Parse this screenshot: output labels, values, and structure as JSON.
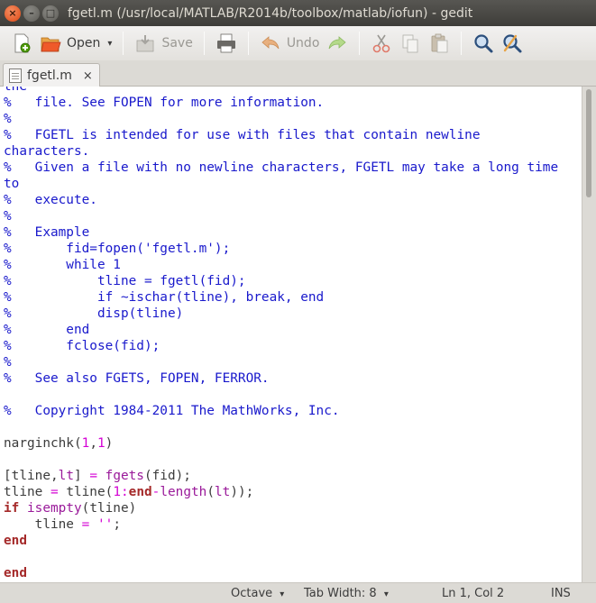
{
  "window": {
    "title": "fgetl.m (/usr/local/MATLAB/R2014b/toolbox/matlab/iofun) - gedit",
    "close_glyph": "×",
    "minimize_glyph": "–",
    "maximize_glyph": "□"
  },
  "toolbar": {
    "new_icon": "new-document-icon",
    "open_label": "Open",
    "open_caret": "▾",
    "save_label": "Save",
    "undo_label": "Undo"
  },
  "tabs": [
    {
      "label": "fgetl.m",
      "close_glyph": "×"
    }
  ],
  "editor": {
    "lines": [
      [
        [
          "c",
          "the"
        ]
      ],
      [
        [
          "c",
          "%   file. See FOPEN for more information."
        ]
      ],
      [
        [
          "c",
          "%"
        ]
      ],
      [
        [
          "c",
          "%   FGETL is intended for use with files that contain newline"
        ]
      ],
      [
        [
          "c",
          "characters."
        ]
      ],
      [
        [
          "c",
          "%   Given a file with no newline characters, FGETL may take a long time"
        ]
      ],
      [
        [
          "c",
          "to"
        ]
      ],
      [
        [
          "c",
          "%   execute."
        ]
      ],
      [
        [
          "c",
          "%"
        ]
      ],
      [
        [
          "c",
          "%   Example"
        ]
      ],
      [
        [
          "c",
          "%       fid=fopen('fgetl.m');"
        ]
      ],
      [
        [
          "c",
          "%       while 1"
        ]
      ],
      [
        [
          "c",
          "%           tline = fgetl(fid);"
        ]
      ],
      [
        [
          "c",
          "%           if ~ischar(tline), break, end"
        ]
      ],
      [
        [
          "c",
          "%           disp(tline)"
        ]
      ],
      [
        [
          "c",
          "%       end"
        ]
      ],
      [
        [
          "c",
          "%       fclose(fid);"
        ]
      ],
      [
        [
          "c",
          "%"
        ]
      ],
      [
        [
          "c",
          "%   See also FGETS, FOPEN, FERROR."
        ]
      ],
      [],
      [
        [
          "c",
          "%   Copyright 1984-2011 The MathWorks, Inc."
        ]
      ],
      [],
      [
        [
          "p",
          "narginchk("
        ],
        [
          "n",
          "1"
        ],
        [
          "p",
          ","
        ],
        [
          "n",
          "1"
        ],
        [
          "p",
          ")"
        ]
      ],
      [],
      [
        [
          "p",
          "[tline,"
        ],
        [
          "f",
          "lt"
        ],
        [
          "p",
          "] "
        ],
        [
          "s",
          "="
        ],
        [
          "p",
          " "
        ],
        [
          "f",
          "fgets"
        ],
        [
          "p",
          "(fid);"
        ]
      ],
      [
        [
          "p",
          "tline "
        ],
        [
          "s",
          "="
        ],
        [
          "p",
          " tline("
        ],
        [
          "n",
          "1"
        ],
        [
          "s",
          ":"
        ],
        [
          "k",
          "end"
        ],
        [
          "s",
          "-"
        ],
        [
          "f",
          "length"
        ],
        [
          "p",
          "("
        ],
        [
          "f",
          "lt"
        ],
        [
          "p",
          "));"
        ]
      ],
      [
        [
          "k",
          "if"
        ],
        [
          "p",
          " "
        ],
        [
          "f",
          "isempty"
        ],
        [
          "p",
          "(tline)"
        ]
      ],
      [
        [
          "p",
          "    tline "
        ],
        [
          "s",
          "="
        ],
        [
          "p",
          " "
        ],
        [
          "s",
          "''"
        ],
        [
          "p",
          ";"
        ]
      ],
      [
        [
          "k",
          "end"
        ]
      ],
      [],
      [
        [
          "k",
          "end"
        ]
      ]
    ]
  },
  "statusbar": {
    "language": "Octave",
    "language_caret": "▾",
    "tab_width": "Tab Width: 8",
    "tab_width_caret": "▾",
    "position": "Ln 1, Col 2",
    "mode": "INS"
  }
}
